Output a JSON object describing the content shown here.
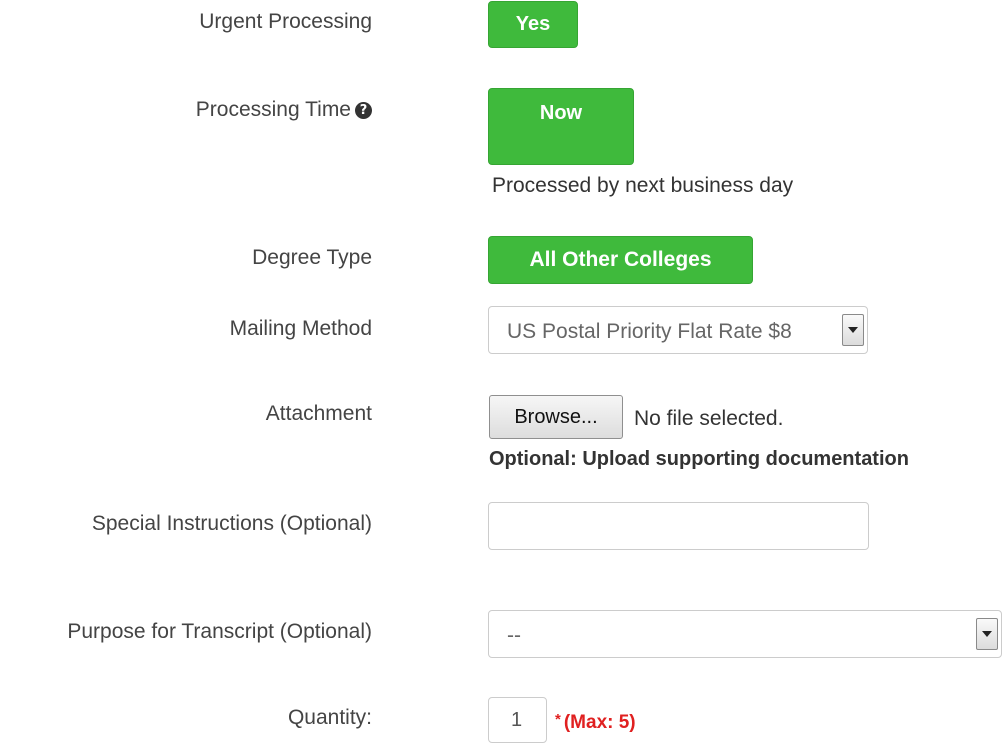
{
  "form": {
    "urgent": {
      "label": "Urgent Processing",
      "button": "Yes"
    },
    "processing_time": {
      "label": "Processing Time",
      "help_icon": "question-circle-icon",
      "button": "Now",
      "helper": "Processed by next business day"
    },
    "degree_type": {
      "label": "Degree Type",
      "button": "All Other Colleges"
    },
    "mailing": {
      "label": "Mailing Method",
      "selected": "US Postal Priority Flat Rate $8"
    },
    "attachment": {
      "label": "Attachment",
      "browse": "Browse...",
      "status": "No file selected.",
      "note": "Optional: Upload supporting documentation"
    },
    "special": {
      "label": "Special Instructions (Optional)",
      "value": ""
    },
    "purpose": {
      "label": "Purpose for Transcript (Optional)",
      "selected": "--"
    },
    "quantity": {
      "label": "Quantity:",
      "value": "1",
      "asterisk": "*",
      "note": "(Max: 5)"
    }
  },
  "colors": {
    "button_green": "#3fba3c",
    "required_red": "#e02020"
  }
}
